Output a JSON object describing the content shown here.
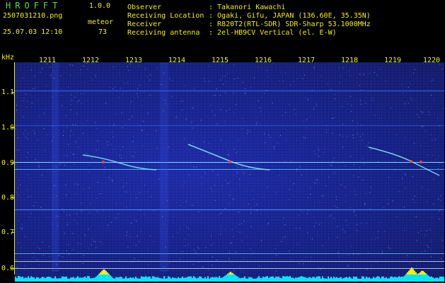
{
  "app": {
    "title": "HROFFT",
    "version": "1.0.0"
  },
  "file": {
    "name": "2507031210.png",
    "datetime": "25.07.03 12:10"
  },
  "meteor": {
    "label": "meteor",
    "count": "73"
  },
  "info": [
    {
      "label": "Observer",
      "value": ": Takanori Kawachi"
    },
    {
      "label": "Receiving Location",
      "value": ": Ogaki, Gifu, JAPAN (136.60E, 35.35N)"
    },
    {
      "label": "Receiver",
      "value": ": R820T2(RTL-SDR) SDR-Sharp 53.1000MHz"
    },
    {
      "label": "Receiving antenna",
      "value": ": 2el-HB9CV Vertical (el. E-W)"
    }
  ],
  "axis": {
    "unit": "kHz",
    "minutes": [
      "1211",
      "1212",
      "1213",
      "1214",
      "1215",
      "1216",
      "1217",
      "1218",
      "1219",
      "1220"
    ],
    "freq_labels": [
      "1.1",
      "1.0",
      "0.9",
      "0.8",
      "0.7",
      "0.6"
    ]
  },
  "colors": {
    "text": "#f0f000",
    "title_green": "#4ee04e",
    "background": "#000000",
    "bars": "#00e5ff",
    "peaks": "#f0f000"
  }
}
